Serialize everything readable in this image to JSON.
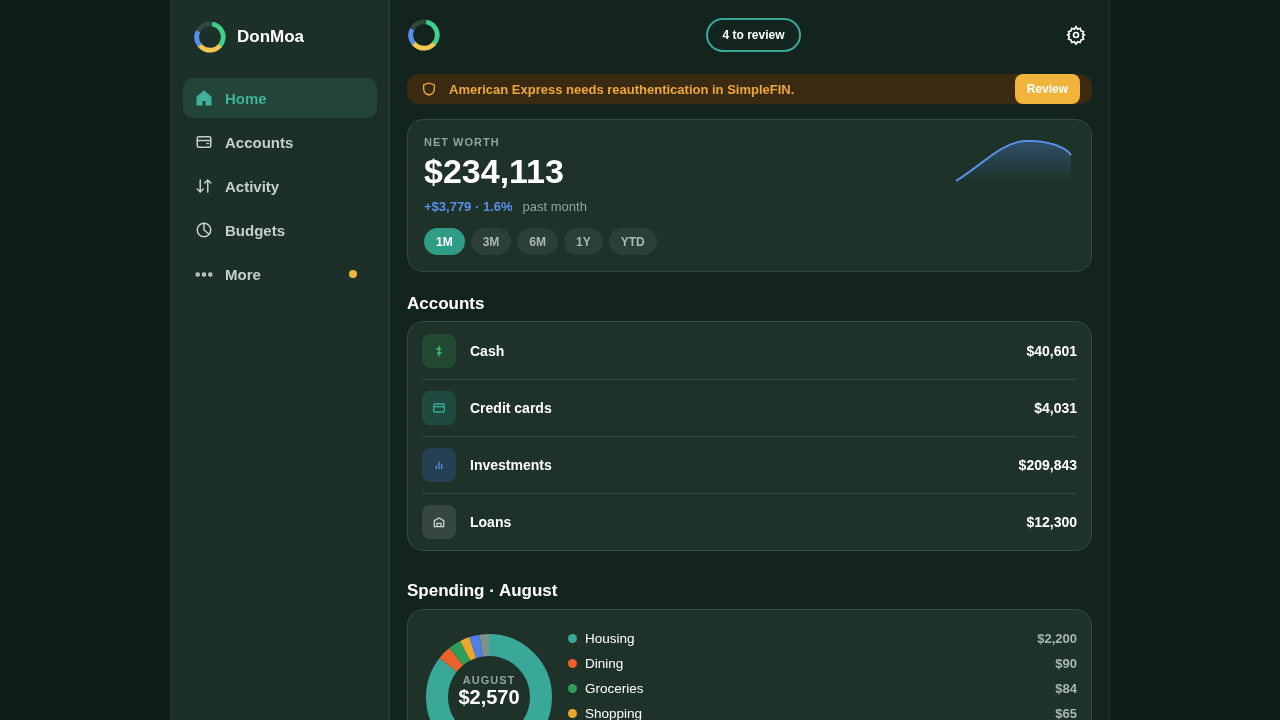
{
  "brand": {
    "name": "DonMoa"
  },
  "nav": [
    {
      "label": "Home",
      "kind": "home",
      "selected": true,
      "dot": false
    },
    {
      "label": "Accounts",
      "kind": "wallet",
      "selected": false,
      "dot": false
    },
    {
      "label": "Activity",
      "kind": "arrows",
      "selected": false,
      "dot": false
    },
    {
      "label": "Budgets",
      "kind": "clock",
      "selected": false,
      "dot": false
    },
    {
      "label": "More",
      "kind": "dots",
      "selected": false,
      "dot": true
    }
  ],
  "header": {
    "review_pill": "4 to review"
  },
  "alert": {
    "message": "American Express needs reauthentication in SimpleFIN.",
    "action": "Review"
  },
  "net_worth": {
    "label": "NET WORTH",
    "value": "$234,113",
    "change": "+$3,779 · 1.6%",
    "period": "past month",
    "ranges": [
      {
        "label": "1M",
        "selected": true
      },
      {
        "label": "3M",
        "selected": false
      },
      {
        "label": "6M",
        "selected": false
      },
      {
        "label": "1Y",
        "selected": false
      },
      {
        "label": "YTD",
        "selected": false
      }
    ]
  },
  "accounts": {
    "title": "Accounts",
    "rows": [
      {
        "kind": "cash",
        "name": "Cash",
        "amount": "$40,601"
      },
      {
        "kind": "card",
        "name": "Credit cards",
        "amount": "$4,031"
      },
      {
        "kind": "invest",
        "name": "Investments",
        "amount": "$209,843"
      },
      {
        "kind": "loan",
        "name": "Loans",
        "amount": "$12,300"
      }
    ]
  },
  "spending": {
    "title": "Spending · August",
    "center_label": "AUGUST",
    "center_value": "$2,570",
    "categories": [
      {
        "name": "Housing",
        "amount": "$2,200",
        "color": "#3aa898"
      },
      {
        "name": "Dining",
        "amount": "$90",
        "color": "#f0602a"
      },
      {
        "name": "Groceries",
        "amount": "$84",
        "color": "#2f9e5a"
      },
      {
        "name": "Shopping",
        "amount": "$65",
        "color": "#e8a82e"
      }
    ]
  }
}
